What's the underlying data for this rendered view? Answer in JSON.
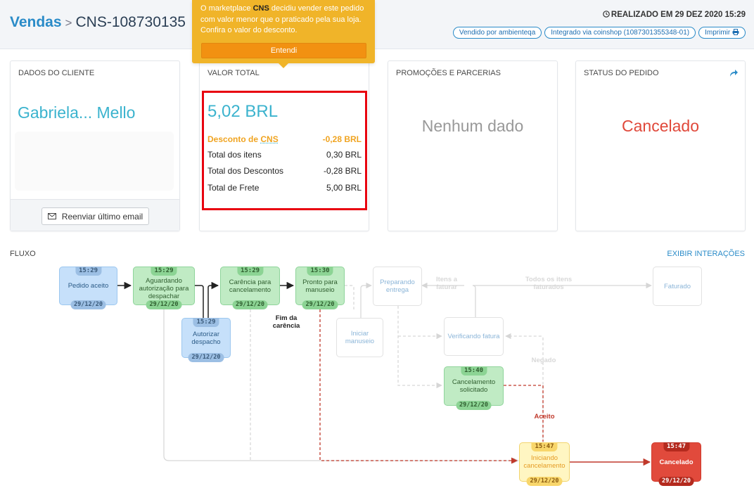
{
  "header": {
    "breadcrumb_link": "Vendas",
    "breadcrumb_sep": ">",
    "order_id": "CNS-108730135",
    "realizado": "REALIZADO EM 29 DEZ 2020 15:29",
    "pills": [
      "Vendido por ambienteqa",
      "Integrado via coinshop (1087301355348-01)",
      "Imprimir"
    ]
  },
  "tooltip": {
    "text_before": "O marketplace",
    "brand": "CNS",
    "text_after": "decidiu vender este pedido com valor menor que o praticado pela sua loja. Confira o valor do desconto.",
    "button": "Entendi"
  },
  "cards": {
    "cliente": {
      "title": "DADOS DO CLIENTE",
      "name": "Gabriela... Mello",
      "resend": "Reenviar último email"
    },
    "total": {
      "title": "VALOR TOTAL",
      "amount": "5,02 BRL",
      "promo_label": "Desconto de",
      "promo_brand": "CNS",
      "promo_value": "-0,28 BRL",
      "rows": [
        {
          "label": "Total dos itens",
          "value": "0,30 BRL"
        },
        {
          "label": "Total dos Descontos",
          "value": "-0,28 BRL"
        },
        {
          "label": "Total de Frete",
          "value": "5,00 BRL"
        }
      ]
    },
    "promocoes": {
      "title": "PROMOÇÕES E PARCERIAS",
      "empty": "Nenhum dado"
    },
    "status": {
      "title": "STATUS DO PEDIDO",
      "value": "Cancelado"
    }
  },
  "flow": {
    "label": "FLUXO",
    "toggle": "EXIBIR INTERAÇÕES",
    "nodes": {
      "pedido_aceito": {
        "time": "15:29",
        "label": "Pedido aceito",
        "date": "29/12/20"
      },
      "aguardando": {
        "time": "15:29",
        "label": "Aguardando autorização para despachar",
        "date": "29/12/20"
      },
      "autorizar": {
        "time": "15:29",
        "label": "Autorizar despacho",
        "date": "29/12/20"
      },
      "carencia": {
        "time": "15:29",
        "label": "Carência para cancelamento",
        "date": "29/12/20"
      },
      "pronto": {
        "time": "15:30",
        "label": "Pronto para manuseio",
        "date": "29/12/20"
      },
      "iniciar": {
        "label": "Iniciar manuseio"
      },
      "preparando": {
        "label": "Preparando entrega"
      },
      "verificando": {
        "label": "Verificando fatura"
      },
      "faturado": {
        "label": "Faturado"
      },
      "cancel_solic": {
        "time": "15:40",
        "label": "Cancelamento solicitado",
        "date": "29/12/20"
      },
      "iniciando_cancel": {
        "time": "15:47",
        "label": "Iniciando cancelamento",
        "date": "29/12/20"
      },
      "cancelado": {
        "time": "15:47",
        "label": "Cancelado",
        "date": "29/12/20"
      }
    },
    "edge_labels": {
      "fim_carencia": "Fim da carência",
      "itens_faturar": "Itens a faturar",
      "todos_faturados": "Todos os itens faturados",
      "negado": "Negado",
      "aceito": "Aceito"
    }
  },
  "colors": {
    "accent": "#2a8bc8",
    "teal": "#3bb3ce",
    "tooltip": "#f0b429",
    "red": "#e0483a",
    "highlight_box": "#e8000f"
  }
}
